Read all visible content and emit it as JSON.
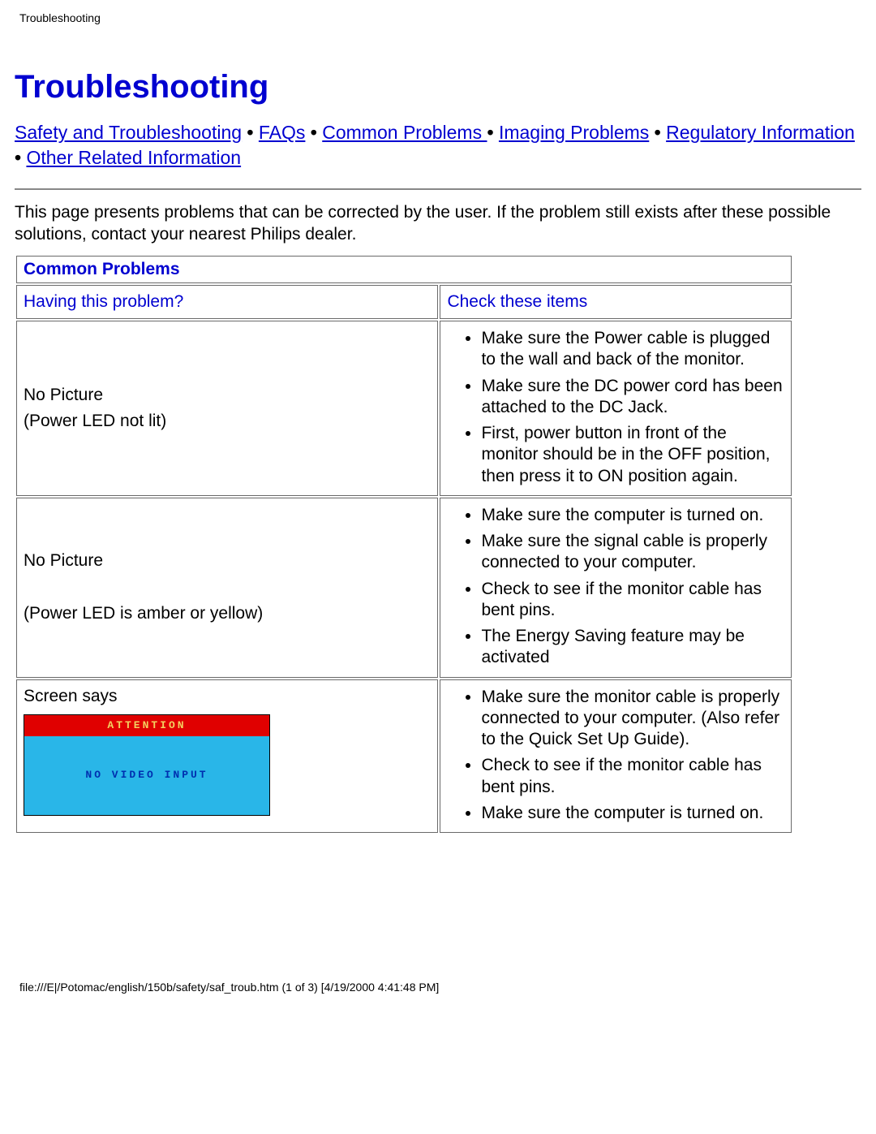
{
  "top_label": "Troubleshooting",
  "title": "Troubleshooting",
  "nav": {
    "l1": "Safety and Troubleshooting",
    "l2": "FAQs",
    "l3": "Common Problems ",
    "l4": "Imaging Problems",
    "l5": "Regulatory Information",
    "l6": "Other Related Information",
    "sep": " • "
  },
  "intro": "This page presents problems that can be corrected by the user. If the problem still exists after these possible solutions, contact your nearest Philips dealer.",
  "table": {
    "section_title": "Common Problems",
    "col1_header": "Having this problem?",
    "col2_header": "Check these items",
    "rows": [
      {
        "problem_line1": "No Picture",
        "problem_line2": "(Power LED not lit)",
        "checks": [
          "Make sure the Power cable is plugged to the wall and back of the monitor.",
          "Make sure the DC power cord has been attached to the DC Jack.",
          "First, power button in front of the monitor should be in the OFF position, then press it to ON position again."
        ]
      },
      {
        "problem_line1": "No Picture",
        "problem_line2": "(Power LED is amber or yellow)",
        "checks": [
          "Make sure the computer is turned on.",
          "Make sure the signal cable is properly connected to your computer.",
          "Check to see if the monitor cable has bent pins.",
          "The Energy Saving feature may be activated"
        ]
      },
      {
        "problem_line1": "Screen says",
        "attn_head": "ATTENTION",
        "attn_body": "NO VIDEO INPUT",
        "checks": [
          "Make sure the monitor cable is properly connected to your computer. (Also refer to the Quick Set Up Guide).",
          "Check to see if the monitor cable has bent pins.",
          "Make sure the computer is turned on."
        ]
      }
    ]
  },
  "footer": "file:///E|/Potomac/english/150b/safety/saf_troub.htm (1 of 3) [4/19/2000 4:41:48 PM]"
}
